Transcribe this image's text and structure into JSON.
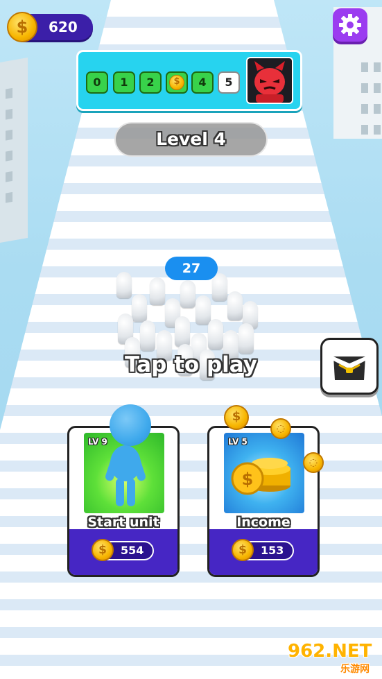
{
  "hud": {
    "coins": "620",
    "coin_symbol": "$"
  },
  "level_progress": {
    "stages": [
      "0",
      "1",
      "2",
      "4",
      "5"
    ],
    "coin_stage_symbol": "$",
    "boss_icon": "devil-icon"
  },
  "level": {
    "label": "Level 4"
  },
  "crowd": {
    "count": "27"
  },
  "prompt": {
    "tap_to_play": "Tap to play"
  },
  "shop": {
    "icon": "shop-bag-icon"
  },
  "cards": [
    {
      "level": "LV 9",
      "title": "Start unit",
      "price": "554",
      "coin_symbol": "$"
    },
    {
      "level": "LV 5",
      "title": "Income",
      "price": "153",
      "coin_symbol": "$"
    }
  ],
  "watermark": {
    "main": "962.NET",
    "sub": "乐游网"
  },
  "colors": {
    "accent_purple": "#4626c4",
    "progress_cyan": "#27d3ef",
    "stage_green": "#38d24a",
    "count_blue": "#1a8ff0",
    "coin_gold": "#f7b500"
  }
}
